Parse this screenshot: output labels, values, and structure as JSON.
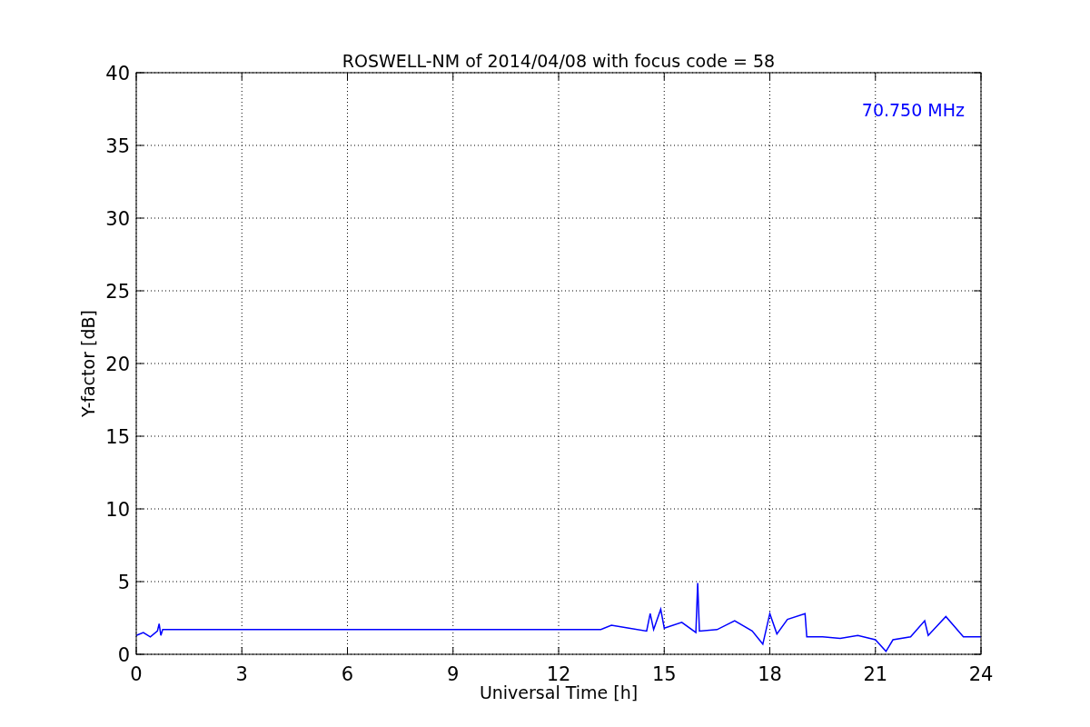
{
  "chart_data": {
    "type": "line",
    "title": "ROSWELL-NM of 2014/04/08 with focus code = 58",
    "xlabel": "Universal Time [h]",
    "ylabel": "Y-factor [dB]",
    "x": [
      0,
      0.2,
      0.4,
      0.6,
      0.65,
      0.7,
      0.75,
      13.2,
      13.5,
      14,
      14.5,
      14.6,
      14.7,
      14.9,
      15,
      15.5,
      15.9,
      15.95,
      16,
      16.5,
      17,
      17.5,
      17.8,
      18,
      18.2,
      18.5,
      19,
      19.05,
      19.5,
      20,
      20.5,
      21,
      21.3,
      21.5,
      22,
      22.4,
      22.5,
      23,
      23.5,
      24
    ],
    "series": [
      {
        "name": "70.750 MHz",
        "color": "#0000ff",
        "values": [
          1.3,
          1.5,
          1.2,
          1.6,
          2.1,
          1.3,
          1.7,
          1.7,
          2.0,
          1.8,
          1.6,
          2.8,
          1.7,
          3.1,
          1.8,
          2.2,
          1.5,
          4.9,
          1.6,
          1.7,
          2.3,
          1.6,
          0.7,
          2.8,
          1.4,
          2.4,
          2.8,
          1.2,
          1.2,
          1.1,
          1.3,
          1.0,
          0.2,
          1.0,
          1.2,
          2.3,
          1.3,
          2.6,
          1.2,
          1.2
        ]
      }
    ],
    "xlim": [
      0,
      24
    ],
    "ylim": [
      0,
      40
    ],
    "xticks": [
      0,
      3,
      6,
      9,
      12,
      15,
      18,
      21,
      24
    ],
    "yticks": [
      0,
      5,
      10,
      15,
      20,
      25,
      30,
      35,
      40
    ],
    "grid": true
  }
}
